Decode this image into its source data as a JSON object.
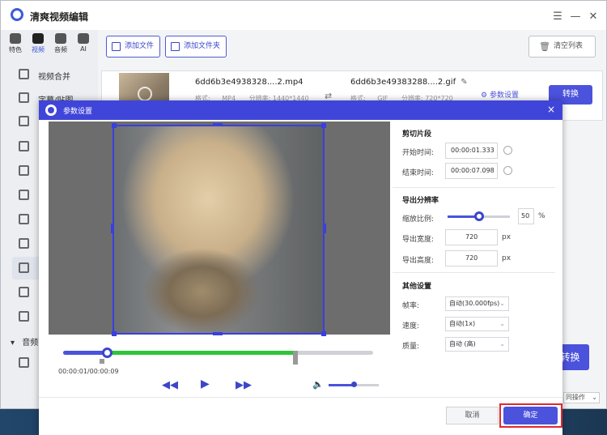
{
  "app": {
    "title": "清爽视频编辑"
  },
  "categories": [
    {
      "label": "特色"
    },
    {
      "label": "视频"
    },
    {
      "label": "音频"
    },
    {
      "label": "AI"
    }
  ],
  "nav": {
    "items": [
      {
        "label": "视频合并"
      },
      {
        "label": "字幕/贴图"
      }
    ],
    "section_audio": "音频"
  },
  "toolbar": {
    "add_file": "添加文件",
    "add_folder": "添加文件夹",
    "clear_list": "清空列表"
  },
  "file": {
    "input_name": "6dd6b3e4938328....2.mp4",
    "input_format_label": "格式:",
    "input_format": "MP4",
    "input_res_label": "分辨率:",
    "input_res": "1440*1440",
    "output_name": "6dd6b3e49383288....2.gif",
    "output_format_label": "格式:",
    "output_format": "GIF",
    "output_res_label": "分辨率:",
    "output_res": "720*720",
    "param_settings": "参数设置",
    "convert": "转换"
  },
  "bottom": {
    "convert_big": "转换",
    "more_ops": "同操作"
  },
  "dialog": {
    "title": "参数设置",
    "close": "×",
    "time_display": "00:00:01/00:00:09",
    "progress": {
      "start_handle": 0.14,
      "played_end": 0.75
    },
    "volume": 0.5,
    "clip_section": "剪切片段",
    "start_label": "开始时间:",
    "start_value": "00:00:01.333",
    "end_label": "结束时间:",
    "end_value": "00:00:07.098",
    "resolution_section": "导出分辨率",
    "scale_label": "缩放比例:",
    "scale_value": "50",
    "scale_unit": "%",
    "scale_fraction": 0.5,
    "width_label": "导出宽度:",
    "width_value": "720",
    "height_label": "导出高度:",
    "height_value": "720",
    "px_unit": "px",
    "other_section": "其他设置",
    "fps_label": "帧率:",
    "fps_value": "自动(30.000fps)",
    "speed_label": "速度:",
    "speed_value": "自动(1x)",
    "quality_label": "质量:",
    "quality_value": "自动 (高)",
    "cancel": "取消",
    "confirm": "确定"
  },
  "colors": {
    "accent": "#4045d9",
    "played": "#2ec53a",
    "highlight_border": "#e0282e"
  }
}
